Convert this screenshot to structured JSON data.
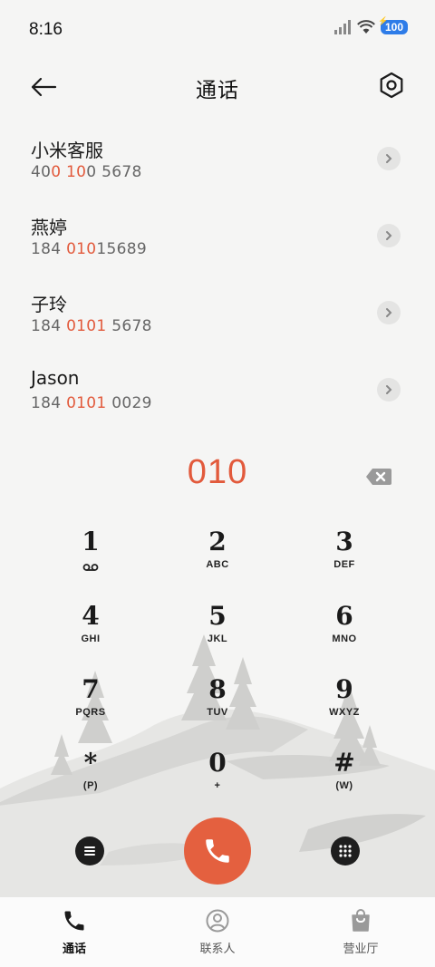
{
  "status": {
    "time": "8:16",
    "battery": "100"
  },
  "header": {
    "title": "通话"
  },
  "contacts": [
    {
      "name": "小米客服",
      "number_parts": [
        "40",
        "0 10",
        "0 5678"
      ]
    },
    {
      "name": "燕婷",
      "number_parts": [
        "184 ",
        "010",
        "15689"
      ]
    },
    {
      "name": "子玲",
      "number_parts": [
        "184 ",
        "0101",
        " 5678"
      ]
    },
    {
      "name": "Jason",
      "number_parts": [
        "184 ",
        "0101",
        " 0029"
      ]
    }
  ],
  "dial": {
    "input": "010"
  },
  "keypad": [
    {
      "digit": "1",
      "letters": ""
    },
    {
      "digit": "2",
      "letters": "ABC"
    },
    {
      "digit": "3",
      "letters": "DEF"
    },
    {
      "digit": "4",
      "letters": "GHI"
    },
    {
      "digit": "5",
      "letters": "JKL"
    },
    {
      "digit": "6",
      "letters": "MNO"
    },
    {
      "digit": "7",
      "letters": "PQRS"
    },
    {
      "digit": "8",
      "letters": "TUV"
    },
    {
      "digit": "9",
      "letters": "WXYZ"
    },
    {
      "digit": "*",
      "letters": "(P)"
    },
    {
      "digit": "0",
      "letters": "+"
    },
    {
      "digit": "#",
      "letters": "(W)"
    }
  ],
  "nav": {
    "tabs": [
      {
        "label": "通话",
        "icon": "phone-icon",
        "active": true
      },
      {
        "label": "联系人",
        "icon": "person-icon",
        "active": false
      },
      {
        "label": "营业厅",
        "icon": "shopping-bag-icon",
        "active": false
      }
    ]
  },
  "colors": {
    "accent": "#e25a3c",
    "call_button": "#e4603f",
    "battery": "#2e7ce8"
  }
}
